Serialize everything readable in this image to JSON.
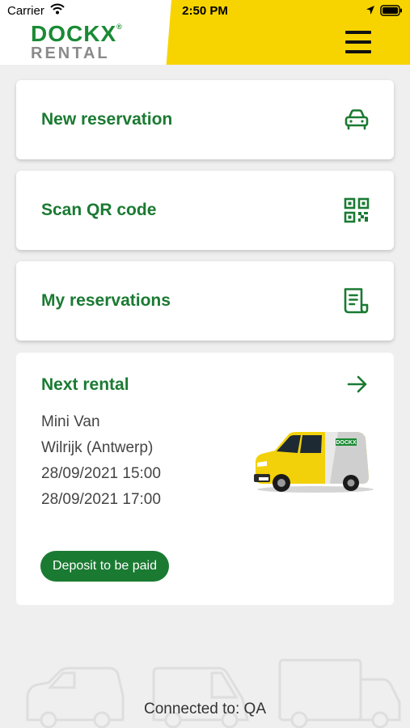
{
  "status_bar": {
    "carrier": "Carrier",
    "time": "2:50 PM"
  },
  "header": {
    "logo_top": "DOCKX",
    "logo_mark": "®",
    "logo_bottom": "RENTAL"
  },
  "actions": [
    {
      "label": "New reservation",
      "icon": "car-icon"
    },
    {
      "label": "Scan QR code",
      "icon": "qr-code-icon"
    },
    {
      "label": "My reservations",
      "icon": "document-icon"
    }
  ],
  "next_rental": {
    "title": "Next rental",
    "vehicle": "Mini Van",
    "location": "Wilrijk (Antwerp)",
    "start": "28/09/2021 15:00",
    "end": "28/09/2021 17:00",
    "badge": "Deposit to be paid",
    "van_brand_text": "DOCKX"
  },
  "footer": {
    "connection": "Connected to: QA"
  },
  "colors": {
    "brand_green": "#1a7a32",
    "brand_yellow": "#f7d400",
    "background": "#efefef"
  }
}
